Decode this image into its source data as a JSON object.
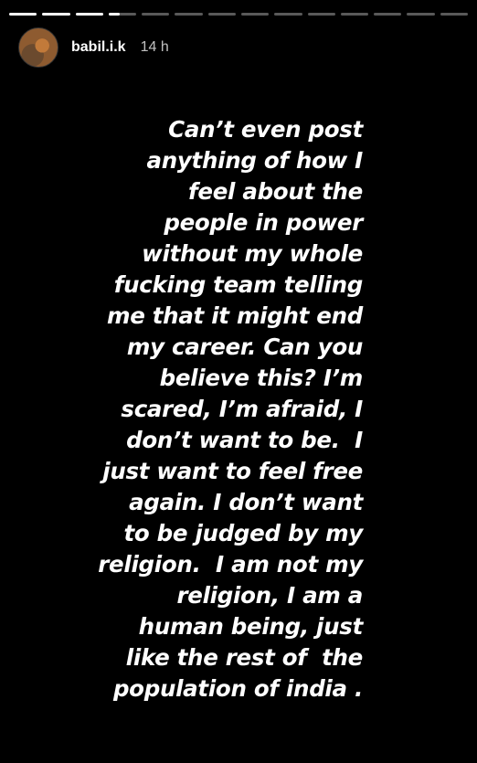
{
  "story": {
    "progress": {
      "segments_total": 15,
      "segments_completed": 3,
      "active_segment_fill": 0.4
    },
    "author": {
      "username": "babil.i.k",
      "time_ago": "14 h",
      "avatar_icon": "profile-photo"
    },
    "text_lines": [
      "Can’t even post",
      "anything of how I",
      "feel about the",
      "people in power",
      "without my whole",
      "fucking team telling",
      "me that it might end",
      "my career. Can you",
      "believe this? I’m",
      "scared, I’m afraid, I",
      "don’t want to be.  I",
      "just want to feel free",
      "again. I don’t want",
      "to be judged by my",
      "religion.  I am not my",
      "religion, I am a",
      "human being, just",
      "like the rest of  the",
      "population of india ."
    ],
    "colors": {
      "background": "#000000",
      "text": "#ffffff"
    }
  }
}
